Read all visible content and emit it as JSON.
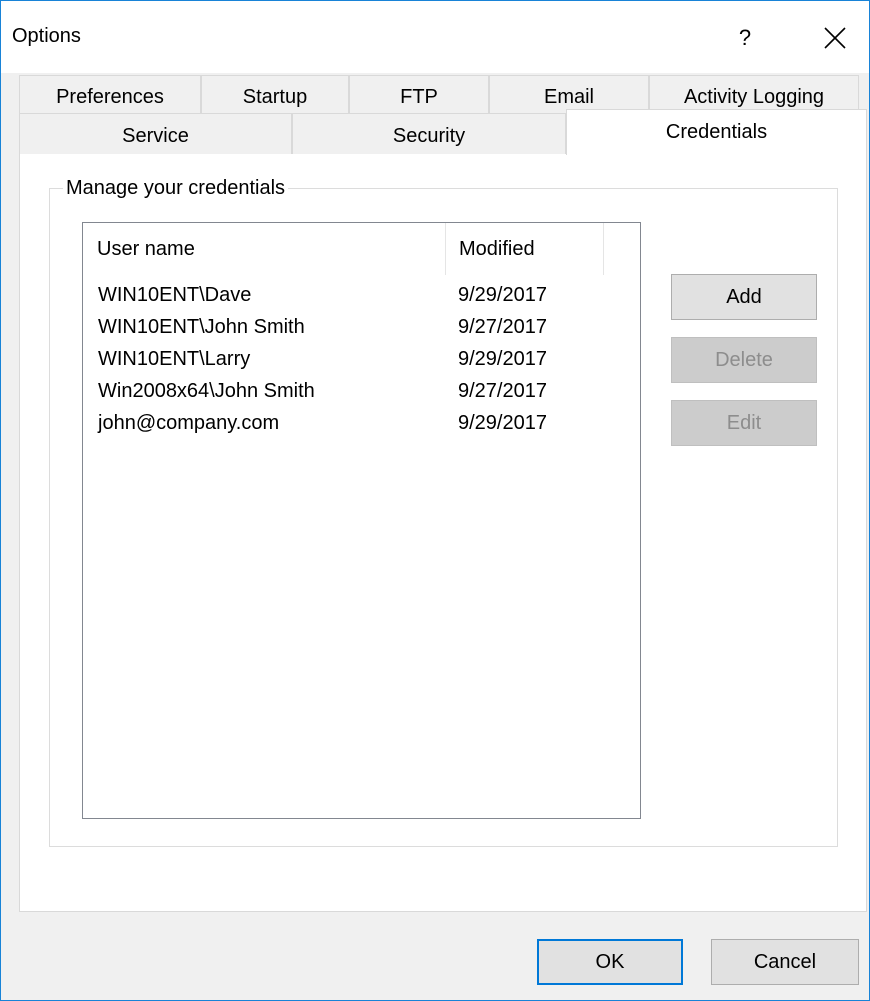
{
  "window": {
    "title": "Options",
    "help_label": "?"
  },
  "tabs": {
    "row1": [
      {
        "label": "Preferences"
      },
      {
        "label": "Startup"
      },
      {
        "label": "FTP"
      },
      {
        "label": "Email"
      },
      {
        "label": "Activity Logging"
      }
    ],
    "row2": [
      {
        "label": "Service"
      },
      {
        "label": "Security"
      },
      {
        "label": "Credentials",
        "selected": true
      }
    ]
  },
  "credentials": {
    "group_label": "Manage your credentials",
    "columns": [
      "User name",
      "Modified"
    ],
    "rows": [
      {
        "user": "WIN10ENT\\Dave",
        "modified": "9/29/2017"
      },
      {
        "user": "WIN10ENT\\John Smith",
        "modified": "9/27/2017"
      },
      {
        "user": "WIN10ENT\\Larry",
        "modified": "9/29/2017"
      },
      {
        "user": "Win2008x64\\John Smith",
        "modified": "9/27/2017"
      },
      {
        "user": "john@company.com",
        "modified": "9/29/2017"
      }
    ],
    "add_label": "Add",
    "delete_label": "Delete",
    "edit_label": "Edit",
    "delete_enabled": false,
    "edit_enabled": false
  },
  "footer": {
    "ok_label": "OK",
    "cancel_label": "Cancel"
  },
  "colors": {
    "window_border": "#1883d7",
    "default_button_border": "#0078d7",
    "dialog_background": "#f0f0f0"
  }
}
